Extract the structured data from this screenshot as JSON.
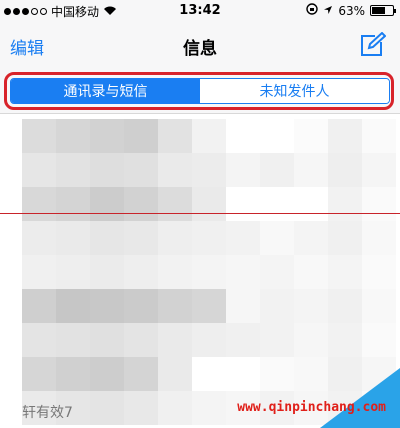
{
  "status_bar": {
    "carrier": "中国移动",
    "time": "13:42",
    "battery": "63%",
    "battery_level": 0.63,
    "signal_bars_filled": 3,
    "signal_bars_total": 5
  },
  "nav": {
    "edit_label": "编辑",
    "title": "信息"
  },
  "segmented": {
    "options": [
      "通讯录与短信",
      "未知发件人"
    ],
    "selected_index": 0
  },
  "list": {
    "footer_text": "轩有效7",
    "pixel_shades": [
      [
        "#dcdcdc",
        "#d6d6d6",
        "#d2d2d2",
        "#cfcfcf",
        "#e2e2e2",
        "#f2f2f2",
        "#ffffff",
        "#ffffff",
        "#fbfbfb",
        "#f0f0f0",
        "#fafafa"
      ],
      [
        "#e6e6e6",
        "#e2e2e2",
        "#dedede",
        "#e0e0e0",
        "#eaeaea",
        "#ececec",
        "#f4f4f4",
        "#f0f0f0",
        "#f6f6f6",
        "#eeeeee",
        "#f5f5f5"
      ],
      [
        "#d8d8d8",
        "#d4d4d4",
        "#cccccc",
        "#d2d2d2",
        "#dcdcdc",
        "#eaeaea",
        "#ffffff",
        "#ffffff",
        "#ffffff",
        "#f2f2f2",
        "#fafafa"
      ],
      [
        "#ececec",
        "#eaeaea",
        "#e6e6e6",
        "#e8e8e8",
        "#eeeeee",
        "#f0f0f0",
        "#f2f2f2",
        "#f8f8f8",
        "#f4f4f4",
        "#f0f0f0",
        "#f8f8f8"
      ],
      [
        "#f0f0f0",
        "#eeeeee",
        "#ebebeb",
        "#eeeeee",
        "#f2f2f2",
        "#f4f4f4",
        "#f6f6f6",
        "#f4f4f4",
        "#f8f8f8",
        "#f4f4f4",
        "#fafafa"
      ],
      [
        "#cfcfcf",
        "#c6c6c6",
        "#c8c8c8",
        "#cbcbcb",
        "#d2d2d2",
        "#d6d6d6",
        "#f6f6f6",
        "#f2f2f2",
        "#f4f4f4",
        "#f0f0f0",
        "#f8f8f8"
      ],
      [
        "#e4e4e4",
        "#e2e2e2",
        "#e0e0e0",
        "#e4e4e4",
        "#eaeaea",
        "#eeeeee",
        "#f0f0f0",
        "#f2f2f2",
        "#f6f6f6",
        "#f2f2f2",
        "#fafafa"
      ],
      [
        "#d6d6d6",
        "#d0d0d0",
        "#cdcdcd",
        "#d4d4d4",
        "#eaeaea",
        "#ffffff",
        "#ffffff",
        "#fafafa",
        "#f8f8f8",
        "#f0f0f0",
        "#f6f6f6"
      ],
      [
        "#eaeaea",
        "#e6e6e6",
        "#e4e4e4",
        "#e8e8e8",
        "#f0f0f0",
        "#f4f4f4",
        "#f6f6f6",
        "#f2f2f2",
        "#f6f6f6",
        "#f2f2f2",
        "#fafafa"
      ]
    ]
  },
  "watermark": "www.qinpinchang.com",
  "colors": {
    "accent": "#1a7ef2",
    "highlight_border": "#d8232a",
    "corner": "#2aa3e8"
  }
}
